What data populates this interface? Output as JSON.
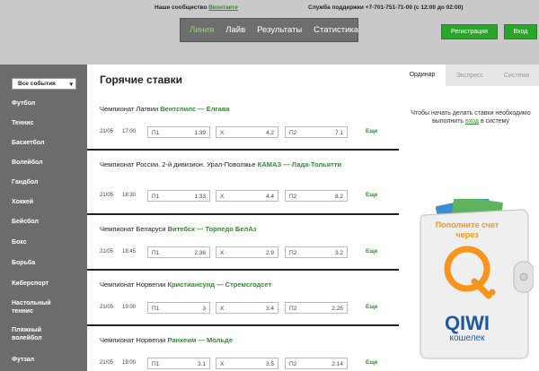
{
  "top": {
    "community_label": "Наше сообщество",
    "community_link": "Вконтакте",
    "support_label": "Служба поддержки",
    "support_phone": "+7-701-751-71-00 (с 12:00 до 02:00)"
  },
  "nav": {
    "items": [
      "Линия",
      "Лайв",
      "Результаты",
      "Статистика"
    ],
    "active": "Линия"
  },
  "auth": {
    "register": "Регистрация",
    "login": "Вход"
  },
  "sidebar": {
    "select_value": "Все события",
    "sports": [
      "Футбол",
      "Теннис",
      "Баскетбол",
      "Волейбол",
      "Гандбол",
      "Хоккей",
      "Бейсбол",
      "Бокс",
      "Борьба",
      "Киберспорт",
      "Настольный теннис",
      "Пляжный волейбол",
      "Футзал"
    ]
  },
  "content": {
    "heading": "Горячие ставки",
    "more_label": "Еще",
    "events": [
      {
        "league": "Чемпионат Латвии",
        "teams": "Вентспилс — Елгава",
        "date": "21/05",
        "time": "17:00",
        "odds": [
          [
            "П1",
            "1.39"
          ],
          [
            "X",
            "4.2"
          ],
          [
            "П2",
            "7.1"
          ]
        ]
      },
      {
        "league": "Чемпионат России. 2-й дивизион. Урал-Поволжье",
        "teams": "КАМАЗ — Лада-Тольятти",
        "date": "21/05",
        "time": "18:30",
        "odds": [
          [
            "П1",
            "1.33"
          ],
          [
            "X",
            "4.4"
          ],
          [
            "П2",
            "8.2"
          ]
        ]
      },
      {
        "league": "Чемпионат Беларуси",
        "teams": "Витебск — Торпедо БелАз",
        "date": "21/05",
        "time": "18:45",
        "odds": [
          [
            "П1",
            "2.36"
          ],
          [
            "X",
            "2.9"
          ],
          [
            "П2",
            "3.2"
          ]
        ]
      },
      {
        "league": "Чемпионат Норвегии",
        "teams": "Кристиансунд — Стремсгодсет",
        "date": "21/05",
        "time": "19:00",
        "odds": [
          [
            "П1",
            "3"
          ],
          [
            "X",
            "3.4"
          ],
          [
            "П2",
            "2.25"
          ]
        ]
      },
      {
        "league": "Чемпионат Норвегии",
        "teams": "Ранхеим — Мольде",
        "date": "21/05",
        "time": "19:00",
        "odds": [
          [
            "П1",
            "3.1"
          ],
          [
            "X",
            "3.5"
          ],
          [
            "П2",
            "2.14"
          ]
        ]
      }
    ]
  },
  "coupon": {
    "tabs": [
      "Ординар",
      "Экспресс",
      "Система"
    ],
    "active_tab": "Ординар",
    "note_before": "Чтобы начать делать ставки необходимо выполнить",
    "note_link": "вход",
    "note_after": "в систему"
  },
  "promo": {
    "line1": "Пополните счет",
    "line2": "через",
    "brand": "QIWI",
    "brand_sub": "кошелек",
    "brand_color": "#f7941d"
  },
  "colors": {
    "accent_green": "#2aa52a",
    "link_green": "#2e8b2e",
    "nav_active": "#8fdc5a"
  }
}
